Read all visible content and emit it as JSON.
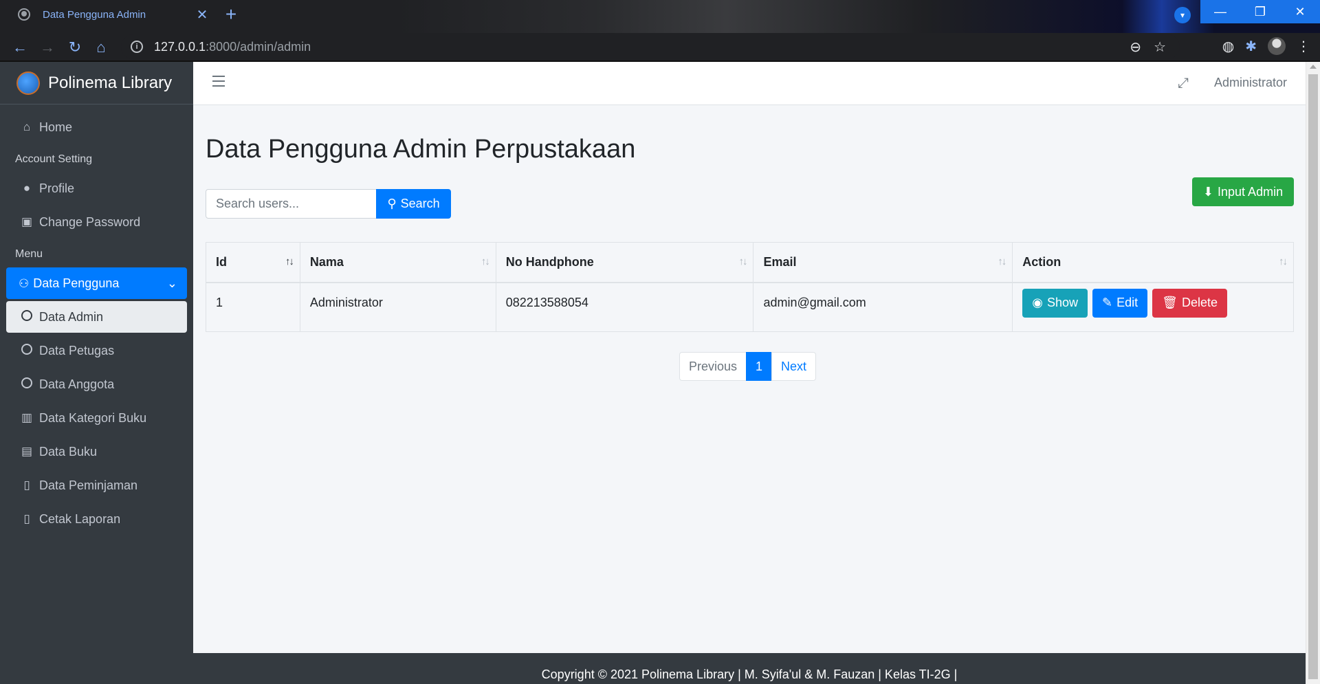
{
  "browser": {
    "tab_title": "Data Pengguna Admin",
    "url_host": "127.0.0.1",
    "url_path": ":8000/admin/admin"
  },
  "sidebar": {
    "brand": "Polinema Library",
    "home": "Home",
    "account_header": "Account Setting",
    "profile": "Profile",
    "change_password": "Change Password",
    "menu_header": "Menu",
    "data_pengguna": "Data Pengguna",
    "data_admin": "Data Admin",
    "data_petugas": "Data Petugas",
    "data_anggota": "Data Anggota",
    "data_kategori_buku": "Data Kategori Buku",
    "data_buku": "Data Buku",
    "data_peminjaman": "Data Peminjaman",
    "cetak_laporan": "Cetak Laporan"
  },
  "topnav": {
    "user": "Administrator"
  },
  "page": {
    "title": "Data Pengguna Admin Perpustakaan",
    "search_placeholder": "Search users...",
    "search_button": "Search",
    "input_admin_button": "Input Admin"
  },
  "table": {
    "headers": [
      "Id",
      "Nama",
      "No Handphone",
      "Email",
      "Action"
    ],
    "rows": [
      {
        "id": "1",
        "nama": "Administrator",
        "phone": "082213588054",
        "email": "admin@gmail.com"
      }
    ],
    "actions": {
      "show": "Show",
      "edit": "Edit",
      "delete": "Delete"
    }
  },
  "pagination": {
    "previous": "Previous",
    "current": "1",
    "next": "Next"
  },
  "footer": {
    "text": "Copyright © 2021 Polinema Library | M. Syifa'ul & M. Fauzan | Kelas TI-2G |"
  },
  "colors": {
    "primary": "#007bff",
    "success": "#28a745",
    "info": "#17a2b8",
    "danger": "#dc3545",
    "sidebar": "#343a40"
  }
}
